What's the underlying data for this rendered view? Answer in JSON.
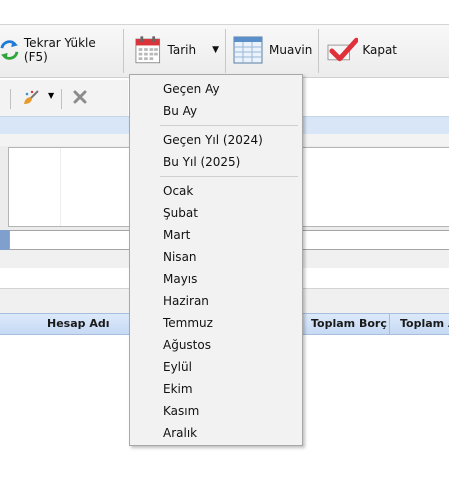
{
  "toolbar": {
    "reload_label": "Tekrar Yükle (F5)",
    "date_label": "Tarih",
    "muavin_label": "Muavin",
    "close_label": "Kapat"
  },
  "grid": {
    "columns": [
      "Hesap Adı",
      "Toplam Borç",
      "Toplam A"
    ]
  },
  "date_menu": {
    "items": [
      "Geçen Ay",
      "Bu Ay",
      "Geçen Yıl (2024)",
      "Bu Yıl (2025)",
      "Ocak",
      "Şubat",
      "Mart",
      "Nisan",
      "Mayıs",
      "Haziran",
      "Temmuz",
      "Ağustos",
      "Eylül",
      "Ekim",
      "Kasım",
      "Aralık"
    ]
  },
  "colors": {
    "accent_blue": "#1e7bd6",
    "check_red": "#e0303a",
    "grid_header": "#c6daf4"
  },
  "icons": [
    "refresh-icon",
    "calendar-icon",
    "dropdown-arrow-icon",
    "table-icon",
    "checkmark-icon",
    "brush-icon",
    "delete-icon"
  ]
}
